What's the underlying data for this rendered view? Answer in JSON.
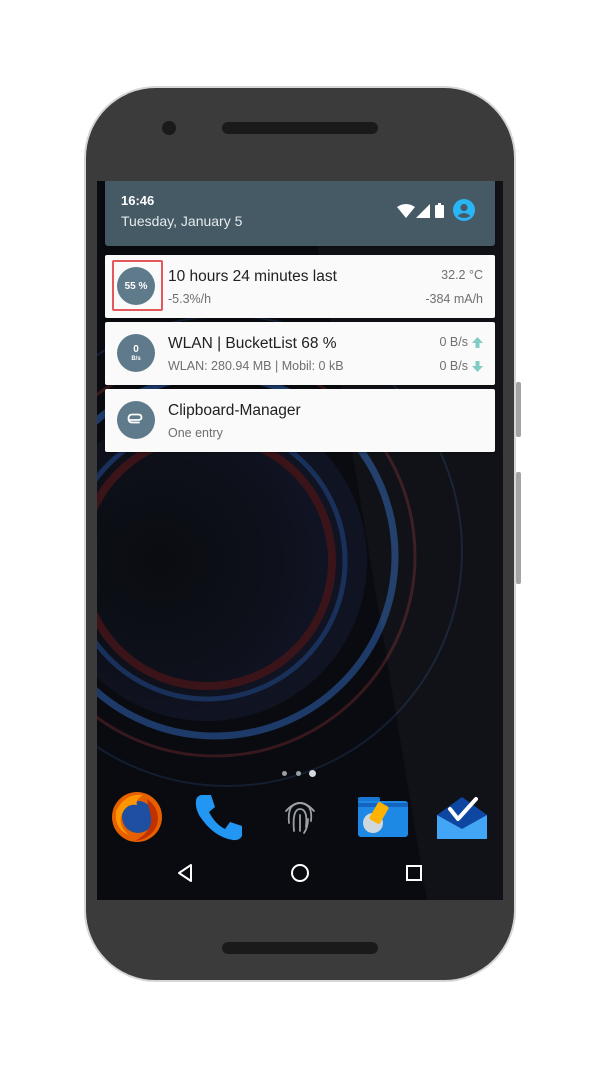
{
  "status_bar": {
    "time": "16:46",
    "date": "Tuesday, January 5",
    "icons": [
      "wifi-icon",
      "cell-signal-icon",
      "battery-icon",
      "account-icon"
    ]
  },
  "notifications": [
    {
      "icon_text": "55 %",
      "title": "10 hours 24 minutes last",
      "subtitle": "-5.3%/h",
      "right_top": "32.2 °C",
      "right_bottom": "-384 mA/h"
    },
    {
      "icon_text": "0",
      "icon_sub": "B/s",
      "title": "WLAN | BucketList 68 %",
      "subtitle": "WLAN: 280.94 MB | Mobil: 0 kB",
      "right_top": "0 B/s",
      "right_bottom": "0 B/s"
    },
    {
      "icon": "paperclip-icon",
      "title": "Clipboard-Manager",
      "subtitle": "One entry"
    }
  ],
  "home_screen": {
    "page_count": 3,
    "dock_apps": [
      "firefox-icon",
      "phone-icon",
      "fingerprint-icon",
      "files-icon",
      "inbox-icon"
    ]
  },
  "nav_bar": [
    "back-icon",
    "home-icon",
    "recents-icon"
  ],
  "colors": {
    "status_bar": "#455a64",
    "icon_circle": "#5f7a8a",
    "highlight": "#e5575b",
    "arrow": "#80cbc4"
  }
}
